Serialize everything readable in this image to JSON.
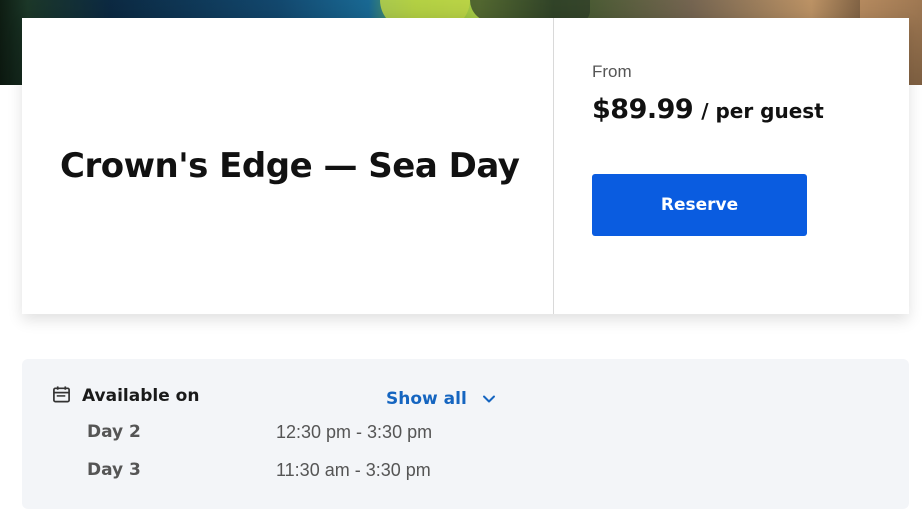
{
  "hero": {
    "icon": "hero-photo"
  },
  "card": {
    "title": "Crown's Edge — Sea Day",
    "from_label": "From",
    "price": "$89.99",
    "per_label": "/ per guest",
    "reserve_label": "Reserve",
    "accent_color": "#0a5ce0"
  },
  "availability": {
    "title": "Available on",
    "icon": "calendar-icon",
    "show_all_label": "Show all",
    "show_all_icon": "chevron-down-icon",
    "link_color": "#1565c0",
    "rows": [
      {
        "day": "Day 2",
        "time": "12:30 pm - 3:30 pm"
      },
      {
        "day": "Day 3",
        "time": "11:30 am - 3:30 pm"
      }
    ]
  }
}
